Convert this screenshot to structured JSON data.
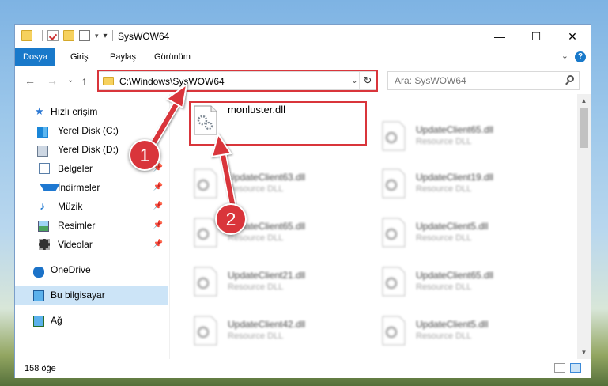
{
  "window": {
    "title": "SysWOW64"
  },
  "controls": {
    "minimize": "—",
    "maximize": "☐",
    "close": "✕"
  },
  "ribbon": {
    "tabs": [
      "Dosya",
      "Giriş",
      "Paylaş",
      "Görünüm"
    ],
    "help": "?"
  },
  "address": {
    "path": "C:\\Windows\\SysWOW64"
  },
  "search": {
    "placeholder": "Ara: SysWOW64"
  },
  "sidebar": {
    "items": [
      {
        "label": "Hızlı erişim",
        "icon": "star-icon"
      },
      {
        "label": "Yerel Disk (C:)",
        "icon": "drive-icon"
      },
      {
        "label": "Yerel Disk (D:)",
        "icon": "drive-icon"
      },
      {
        "label": "Belgeler",
        "icon": "document-icon"
      },
      {
        "label": "İndirmeler",
        "icon": "download-icon"
      },
      {
        "label": "Müzik",
        "icon": "music-icon"
      },
      {
        "label": "Resimler",
        "icon": "pictures-icon"
      },
      {
        "label": "Videolar",
        "icon": "video-icon"
      },
      {
        "label": "OneDrive",
        "icon": "cloud-icon"
      },
      {
        "label": "Bu bilgisayar",
        "icon": "computer-icon"
      },
      {
        "label": "Ağ",
        "icon": "network-icon"
      }
    ]
  },
  "files": {
    "highlighted": {
      "name": "monluster.dll"
    },
    "left": [
      {
        "name": "UpdateClient63.dll",
        "type": "Resource DLL"
      },
      {
        "name": "UpdateClient65.dll",
        "type": "Resource DLL"
      },
      {
        "name": "UpdateClient21.dll",
        "type": "Resource DLL"
      },
      {
        "name": "UpdateClient42.dll",
        "type": "Resource DLL"
      }
    ],
    "right": [
      {
        "name": "UpdateClient65.dll",
        "type": "Resource DLL"
      },
      {
        "name": "UpdateClient19.dll",
        "type": "Resource DLL"
      },
      {
        "name": "UpdateClient5.dll",
        "type": "Resource DLL"
      },
      {
        "name": "UpdateClient65.dll",
        "type": "Resource DLL"
      },
      {
        "name": "UpdateClient5.dll",
        "type": "Resource DLL"
      }
    ]
  },
  "status": {
    "count": "158 öğe"
  },
  "callouts": {
    "one": "1",
    "two": "2"
  },
  "colors": {
    "accent": "#1979ca",
    "highlight": "#d9353b"
  }
}
